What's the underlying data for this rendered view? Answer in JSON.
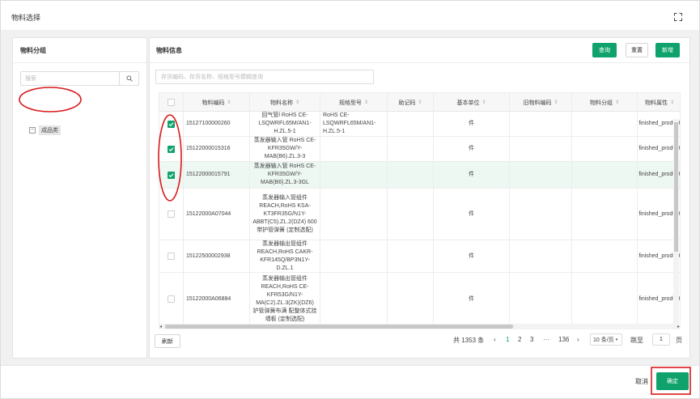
{
  "dialog": {
    "title": "物料选择"
  },
  "left_panel": {
    "title": "物料分组",
    "search_placeholder": "搜索",
    "tree": [
      {
        "label": "成品类",
        "toggle": "−"
      }
    ]
  },
  "right_panel": {
    "title": "物料信息",
    "buttons": {
      "query": "查询",
      "reset": "重置",
      "add": "新增"
    },
    "filter_placeholder": "存货编码、存货名称、规格型号模糊查询"
  },
  "table": {
    "columns": [
      {
        "key": "select",
        "label": ""
      },
      {
        "key": "code",
        "label": "物料编码"
      },
      {
        "key": "name",
        "label": "物料名称"
      },
      {
        "key": "spec",
        "label": "规格型号"
      },
      {
        "key": "mnemonic",
        "label": "助记码"
      },
      {
        "key": "unit",
        "label": "基本单位"
      },
      {
        "key": "old_code",
        "label": "旧物料编码"
      },
      {
        "key": "group",
        "label": "物料分组"
      },
      {
        "key": "attr",
        "label": "物料属性"
      }
    ],
    "sort_glyph": "⇕",
    "rows": [
      {
        "checked": true,
        "code": "15127100000260",
        "name": "回气管l RoHS CE-LSQWRFL65M/AN1-H.ZL.5-1",
        "spec": "RoHS CE-LSQWRFL65M/AN1-H.ZL.5-1",
        "mnemonic": "",
        "unit": "件",
        "old_code": "",
        "group": "",
        "attr": "finished_product"
      },
      {
        "checked": true,
        "code": "15122000015316",
        "name": "蒸发器输入管 RoHS CE-KFR35GW/Y-MAB(B6).ZL.3-3",
        "spec": "",
        "mnemonic": "",
        "unit": "件",
        "old_code": "",
        "group": "",
        "attr": "finished_product"
      },
      {
        "checked": true,
        "code": "15122000015791",
        "name": "蒸发器输入管 RoHS CE-KFR35GW/Y-MAB(B6).ZL.3-3GL",
        "spec": "",
        "mnemonic": "",
        "unit": "件",
        "old_code": "",
        "group": "",
        "attr": "finished_product"
      },
      {
        "checked": false,
        "code": "15122000A07044",
        "name": "蒸发器输入管组件 REACH,RoHS KSA-KT3FR35G/N1Y-ABBT(C5).ZL.2(DZ4) 600带护管弹簧 (定制选配)",
        "spec": "",
        "mnemonic": "",
        "unit": "件",
        "old_code": "",
        "group": "",
        "attr": "finished_product"
      },
      {
        "checked": false,
        "code": "15122500002938",
        "name": "蒸发器输出管组件 REACH,RoHS CAKR-KFR145Q/BP3N1Y-D.ZL.1",
        "spec": "",
        "mnemonic": "",
        "unit": "件",
        "old_code": "",
        "group": "",
        "attr": "finished_product"
      },
      {
        "checked": false,
        "code": "15122000A06884",
        "name": "蒸发器输出管组件 REACH,RoHS CE-KFR53G/N1Y-MA(C2).ZL.3(ZK)(DZ6) 护管弹簧布满 配整体式挂墙板 (定制选配)",
        "spec": "",
        "mnemonic": "",
        "unit": "件",
        "old_code": "",
        "group": "",
        "attr": "finished_product"
      }
    ]
  },
  "footer": {
    "refresh": "刷新",
    "total": "共 1353 条",
    "pages": [
      "1",
      "2",
      "3"
    ],
    "ellipsis": "···",
    "last_page": "136",
    "prev": "‹",
    "next": "›",
    "page_size": "10 条/页",
    "goto_label": "跳至",
    "goto_value": "1",
    "page_unit": "页"
  },
  "actions": {
    "cancel": "取消",
    "confirm": "确定"
  },
  "colors": {
    "accent": "#0fa26d",
    "annotation": "#d9191c"
  },
  "icons": {
    "search": "search-icon",
    "fullscreen": "fullscreen-icon",
    "check": "check-icon"
  }
}
